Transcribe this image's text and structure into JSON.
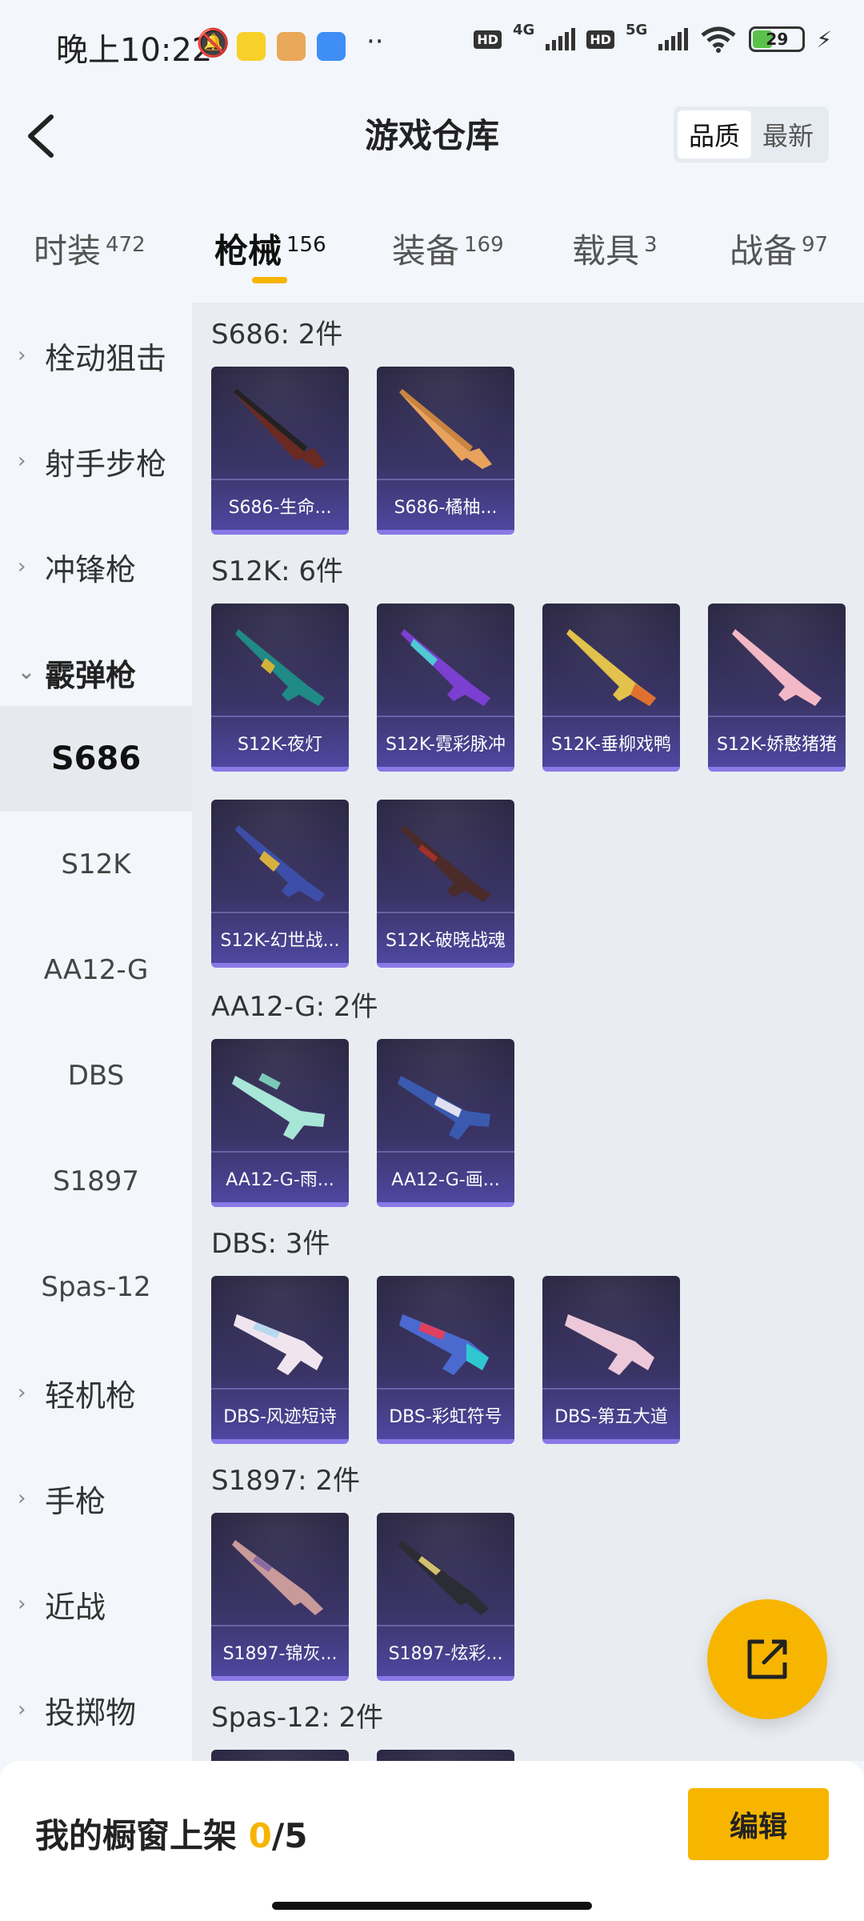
{
  "status": {
    "time": "晚上10:22",
    "network1": "4G",
    "network2": "5G",
    "hd": "HD",
    "battery": "29"
  },
  "header": {
    "title": "游戏仓库",
    "sort_options": [
      "品质",
      "最新"
    ],
    "sort_selected": "品质"
  },
  "tabs": [
    {
      "label": "时装",
      "count": "472"
    },
    {
      "label": "枪械",
      "count": "156"
    },
    {
      "label": "装备",
      "count": "169"
    },
    {
      "label": "载具",
      "count": "3"
    },
    {
      "label": "战备",
      "count": "97"
    }
  ],
  "active_tab": "枪械",
  "sidebar": {
    "categories_top": [
      "栓动狙击",
      "射手步枪",
      "冲锋枪",
      "霰弹枪"
    ],
    "subitems": [
      "S686",
      "S12K",
      "AA12-G",
      "DBS",
      "S1897",
      "Spas-12"
    ],
    "selected_subitem": "S686",
    "categories_bottom": [
      "轻机枪",
      "手枪",
      "近战",
      "投掷物"
    ]
  },
  "groups": [
    {
      "title": "S686: 2件",
      "items": [
        "S686-生命...",
        "S686-橘柚..."
      ]
    },
    {
      "title": "S12K: 6件",
      "items": [
        "S12K-夜灯",
        "S12K-霓彩脉冲",
        "S12K-垂柳戏鸭",
        "S12K-娇憨猪猪",
        "S12K-幻世战...",
        "S12K-破晓战魂"
      ]
    },
    {
      "title": "AA12-G: 2件",
      "items": [
        "AA12-G-雨...",
        "AA12-G-画..."
      ]
    },
    {
      "title": "DBS: 3件",
      "items": [
        "DBS-风迹短诗",
        "DBS-彩虹符号",
        "DBS-第五大道"
      ]
    },
    {
      "title": "S1897: 2件",
      "items": [
        "S1897-锦灰...",
        "S1897-炫彩..."
      ]
    },
    {
      "title": "Spas-12: 2件",
      "items": []
    }
  ],
  "bottom": {
    "label": "我的橱窗上架",
    "current": "0",
    "total": "/5",
    "edit": "编辑"
  },
  "colors": {
    "accent": "#f7b500",
    "card_bg": "#3a3466",
    "card_border": "#8a78e6"
  }
}
